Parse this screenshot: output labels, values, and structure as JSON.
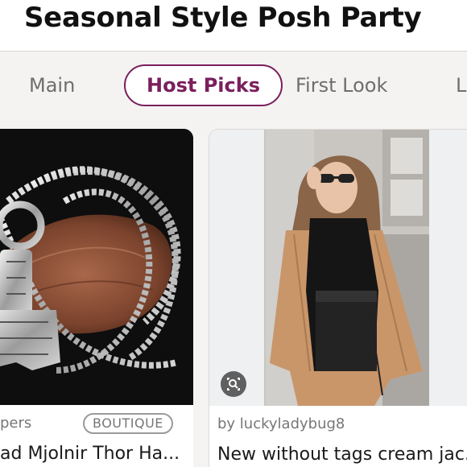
{
  "page": {
    "title": "Seasonal Style Posh Party"
  },
  "tabs": [
    {
      "label": "Main",
      "active": false
    },
    {
      "label": "Host Picks",
      "active": true
    },
    {
      "label": "First Look",
      "active": false
    },
    {
      "label": "L",
      "active": false
    }
  ],
  "listings": [
    {
      "seller": "pers",
      "badge": "BOUTIQUE",
      "title": "ad Mjolnir Thor Ha..."
    },
    {
      "seller": "by luckyladybug8",
      "title": "New without tags cream jac..."
    }
  ],
  "colors": {
    "accent": "#7a1f5c",
    "background": "#f4f3f1"
  },
  "icons": {
    "visual_search": "lens-icon"
  }
}
